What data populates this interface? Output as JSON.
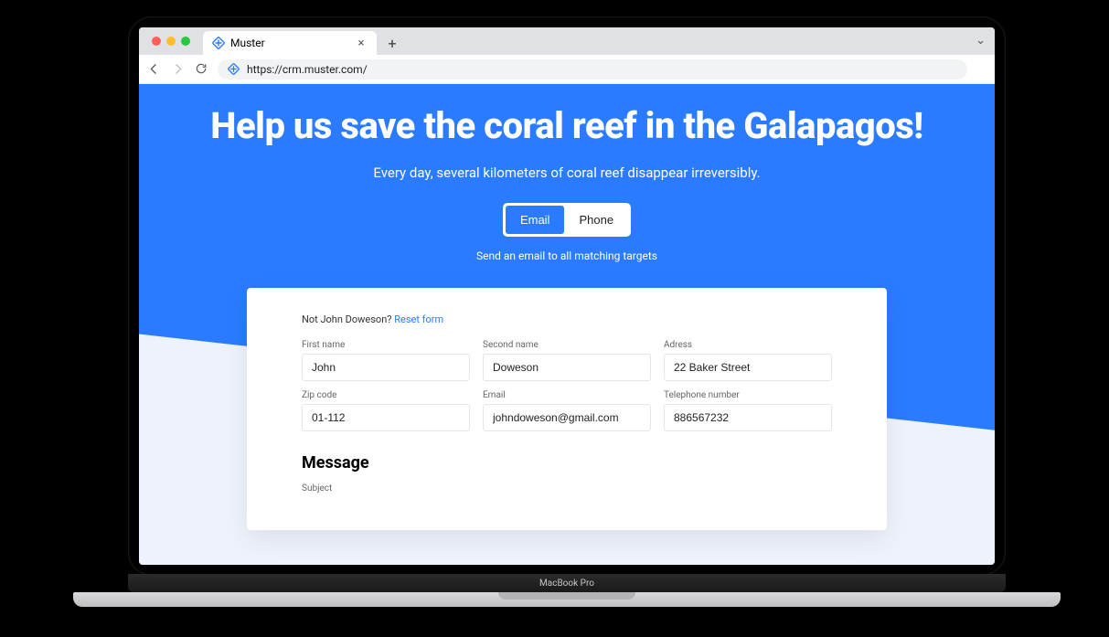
{
  "browser": {
    "tab_title": "Muster",
    "url": "https://crm.muster.com/",
    "device_label": "MacBook Pro"
  },
  "hero": {
    "title": "Help us save the coral reef in the Galapagos!",
    "subtitle": "Every day, several kilometers of coral reef disappear irreversibly.",
    "tab_email": "Email",
    "tab_phone": "Phone",
    "hint": "Send an email to all matching targets"
  },
  "form": {
    "reset_prefix": "Not John Doweson? ",
    "reset_link": "Reset form",
    "fields": {
      "first_name": {
        "label": "First name",
        "value": "John"
      },
      "second_name": {
        "label": "Second name",
        "value": "Doweson"
      },
      "address": {
        "label": "Adress",
        "value": "22 Baker Street"
      },
      "zip": {
        "label": "Zip code",
        "value": "01-112"
      },
      "email": {
        "label": "Email",
        "value": "johndoweson@gmail.com"
      },
      "phone": {
        "label": "Telephone number",
        "value": "886567232"
      }
    },
    "message_heading": "Message",
    "subject_label": "Subject"
  }
}
